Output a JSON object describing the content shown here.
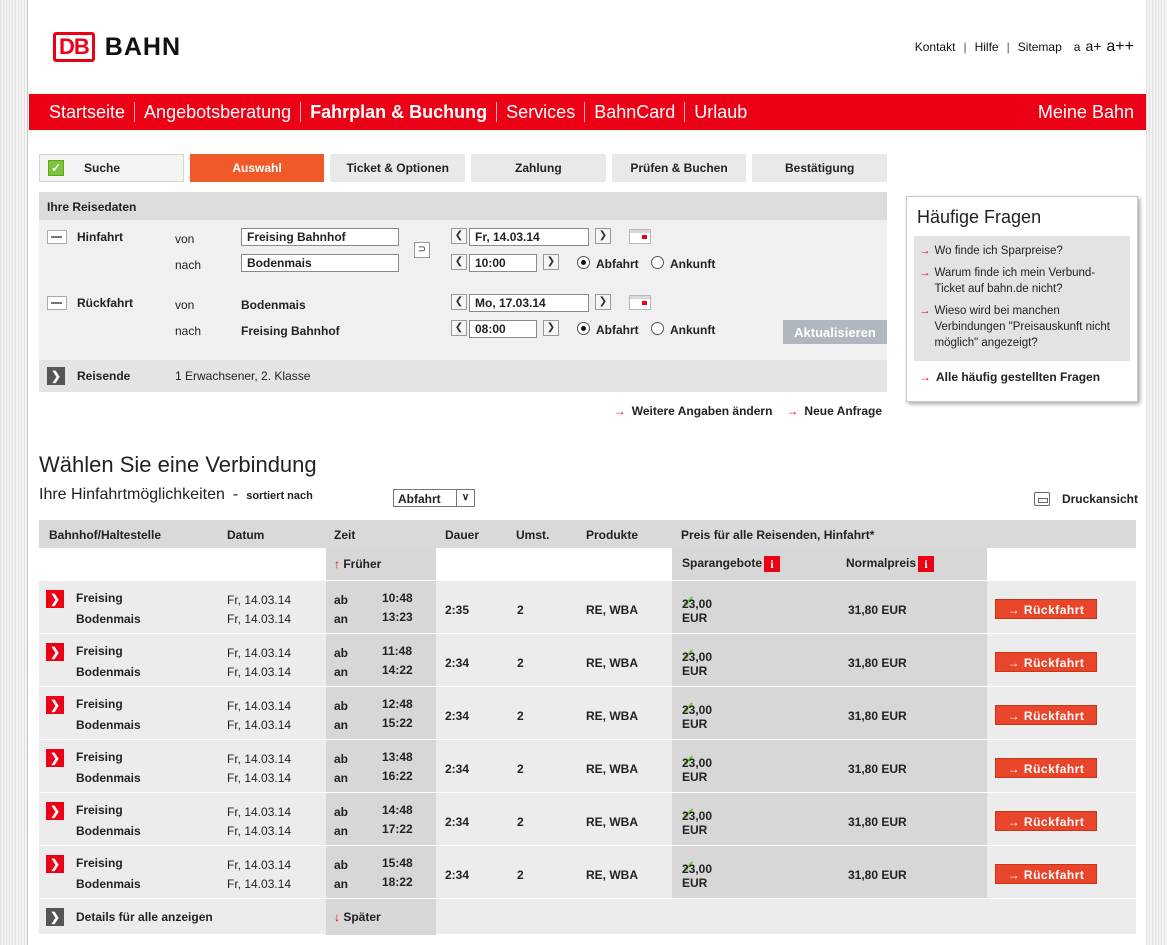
{
  "header": {
    "logo_db": "DB",
    "logo_text": "BAHN",
    "links": [
      "Kontakt",
      "Hilfe",
      "Sitemap"
    ],
    "font_sizes": [
      "a",
      "a+",
      "a++"
    ]
  },
  "nav": {
    "items": [
      "Startseite",
      "Angebotsberatung",
      "Fahrplan & Buchung",
      "Services",
      "BahnCard",
      "Urlaub"
    ],
    "active_index": 2,
    "right": "Meine Bahn"
  },
  "steps": [
    "Suche",
    "Auswahl",
    "Ticket & Optionen",
    "Zahlung",
    "Prüfen & Buchen",
    "Bestätigung"
  ],
  "reisedaten": {
    "title": "Ihre Reisedaten",
    "hinfahrt_label": "Hinfahrt",
    "rueckfahrt_label": "Rückfahrt",
    "von_label": "von",
    "nach_label": "nach",
    "hin_von": "Freising Bahnhof",
    "hin_nach": "Bodenmais",
    "hin_date": "Fr, 14.03.14",
    "hin_time": "10:00",
    "rueck_von": "Bodenmais",
    "rueck_nach": "Freising Bahnhof",
    "rueck_date": "Mo, 17.03.14",
    "rueck_time": "08:00",
    "abfahrt": "Abfahrt",
    "ankunft": "Ankunft",
    "update_button": "Aktualisieren",
    "reisende_label": "Reisende",
    "reisende_value": "1 Erwachsener, 2. Klasse",
    "link_weitere": "Weitere Angaben ändern",
    "link_neue": "Neue Anfrage"
  },
  "faq": {
    "title": "Häufige Fragen",
    "questions": [
      "Wo finde ich Sparpreise?",
      "Warum finde ich mein Verbund-Ticket auf bahn.de nicht?",
      "Wieso wird bei manchen Verbindungen \"Preisauskunft nicht möglich\" angezeigt?"
    ],
    "all": "Alle häufig gestellten Fragen"
  },
  "connections": {
    "title": "Wählen Sie eine Verbindung",
    "subtitle": "Ihre Hinfahrtmöglichkeiten",
    "sorted_by": "sortiert nach",
    "sort_value": "Abfahrt",
    "print": "Druckansicht",
    "headers": {
      "station": "Bahnhof/Haltestelle",
      "date": "Datum",
      "time": "Zeit",
      "duration": "Dauer",
      "changes": "Umst.",
      "products": "Produkte",
      "price": "Preis für alle Reisenden, Hinfahrt*"
    },
    "earlier": "Früher",
    "later": "Später",
    "spar_label": "Sparangebote",
    "normal_label": "Normalpreis",
    "ab": "ab",
    "an": "an",
    "button": "→ Rückfahrt",
    "details_all": "Details für alle anzeigen",
    "rows": [
      {
        "from": "Freising",
        "to": "Bodenmais",
        "date_dep": "Fr, 14.03.14",
        "date_arr": "Fr, 14.03.14",
        "dep": "10:48",
        "arr": "13:23",
        "duration": "2:35",
        "changes": "2",
        "products": "RE, WBA",
        "spar": "23,00 EUR",
        "normal": "31,80 EUR"
      },
      {
        "from": "Freising",
        "to": "Bodenmais",
        "date_dep": "Fr, 14.03.14",
        "date_arr": "Fr, 14.03.14",
        "dep": "11:48",
        "arr": "14:22",
        "duration": "2:34",
        "changes": "2",
        "products": "RE, WBA",
        "spar": "23,00 EUR",
        "normal": "31,80 EUR"
      },
      {
        "from": "Freising",
        "to": "Bodenmais",
        "date_dep": "Fr, 14.03.14",
        "date_arr": "Fr, 14.03.14",
        "dep": "12:48",
        "arr": "15:22",
        "duration": "2:34",
        "changes": "2",
        "products": "RE, WBA",
        "spar": "23,00 EUR",
        "normal": "31,80 EUR"
      },
      {
        "from": "Freising",
        "to": "Bodenmais",
        "date_dep": "Fr, 14.03.14",
        "date_arr": "Fr, 14.03.14",
        "dep": "13:48",
        "arr": "16:22",
        "duration": "2:34",
        "changes": "2",
        "products": "RE, WBA",
        "spar": "23,00 EUR",
        "normal": "31,80 EUR"
      },
      {
        "from": "Freising",
        "to": "Bodenmais",
        "date_dep": "Fr, 14.03.14",
        "date_arr": "Fr, 14.03.14",
        "dep": "14:48",
        "arr": "17:22",
        "duration": "2:34",
        "changes": "2",
        "products": "RE, WBA",
        "spar": "23,00 EUR",
        "normal": "31,80 EUR"
      },
      {
        "from": "Freising",
        "to": "Bodenmais",
        "date_dep": "Fr, 14.03.14",
        "date_arr": "Fr, 14.03.14",
        "dep": "15:48",
        "arr": "18:22",
        "duration": "2:34",
        "changes": "2",
        "products": "RE, WBA",
        "spar": "23,00 EUR",
        "normal": "31,80 EUR"
      }
    ]
  },
  "colors": {
    "brand_red": "#ec0016",
    "step_active": "#f05a28",
    "check_green": "#7cc43a"
  }
}
